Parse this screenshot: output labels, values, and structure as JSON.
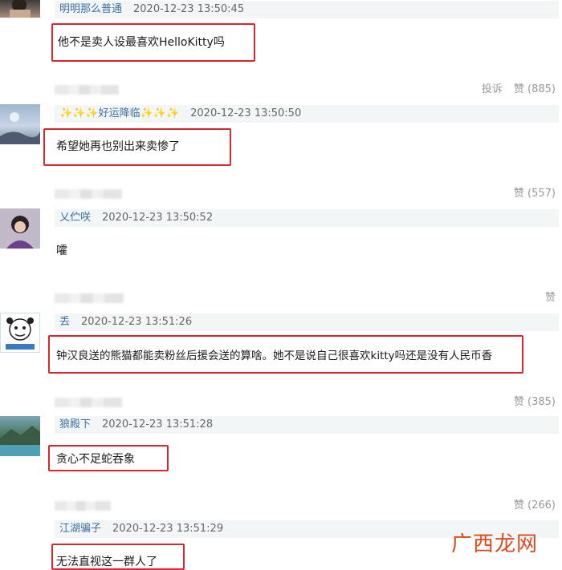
{
  "comments": [
    {
      "username": "明明那么普通",
      "time": "2020-12-23 13:50:45",
      "text": "他不是卖人设最喜欢HelloKitty吗",
      "report": "投诉",
      "like": "赞 (885)"
    },
    {
      "username_prefix": "✨✨✨",
      "username": "好运降临",
      "username_suffix": "✨✨✨",
      "time": "2020-12-23 13:50:50",
      "text": "希望她再也别出来卖惨了",
      "like": "赞 (557)"
    },
    {
      "username": "乂伫咲",
      "time": "2020-12-23 13:50:52",
      "text": "嚯",
      "like": "赞"
    },
    {
      "username": "丢",
      "time": "2020-12-23 13:51:26",
      "text": "钟汉良送的熊猫都能卖粉丝后援会送的算啥。她不是说自己很喜欢kitty吗还是没有人民币香",
      "like": "赞 (385)"
    },
    {
      "username": "狼殿下",
      "time": "2020-12-23 13:51:28",
      "text": "贪心不足蛇吞象",
      "like": "赞 (266)"
    },
    {
      "username": "江湖骗子",
      "time": "2020-12-23 13:51:29",
      "text": "无法直视这一群人了"
    }
  ],
  "watermark": "广西龙网",
  "colors": {
    "username": "#3d6fa6",
    "highlight_border": "#d9262c",
    "header_bg": "#f2f6f6",
    "watermark": "#d94a1e"
  }
}
